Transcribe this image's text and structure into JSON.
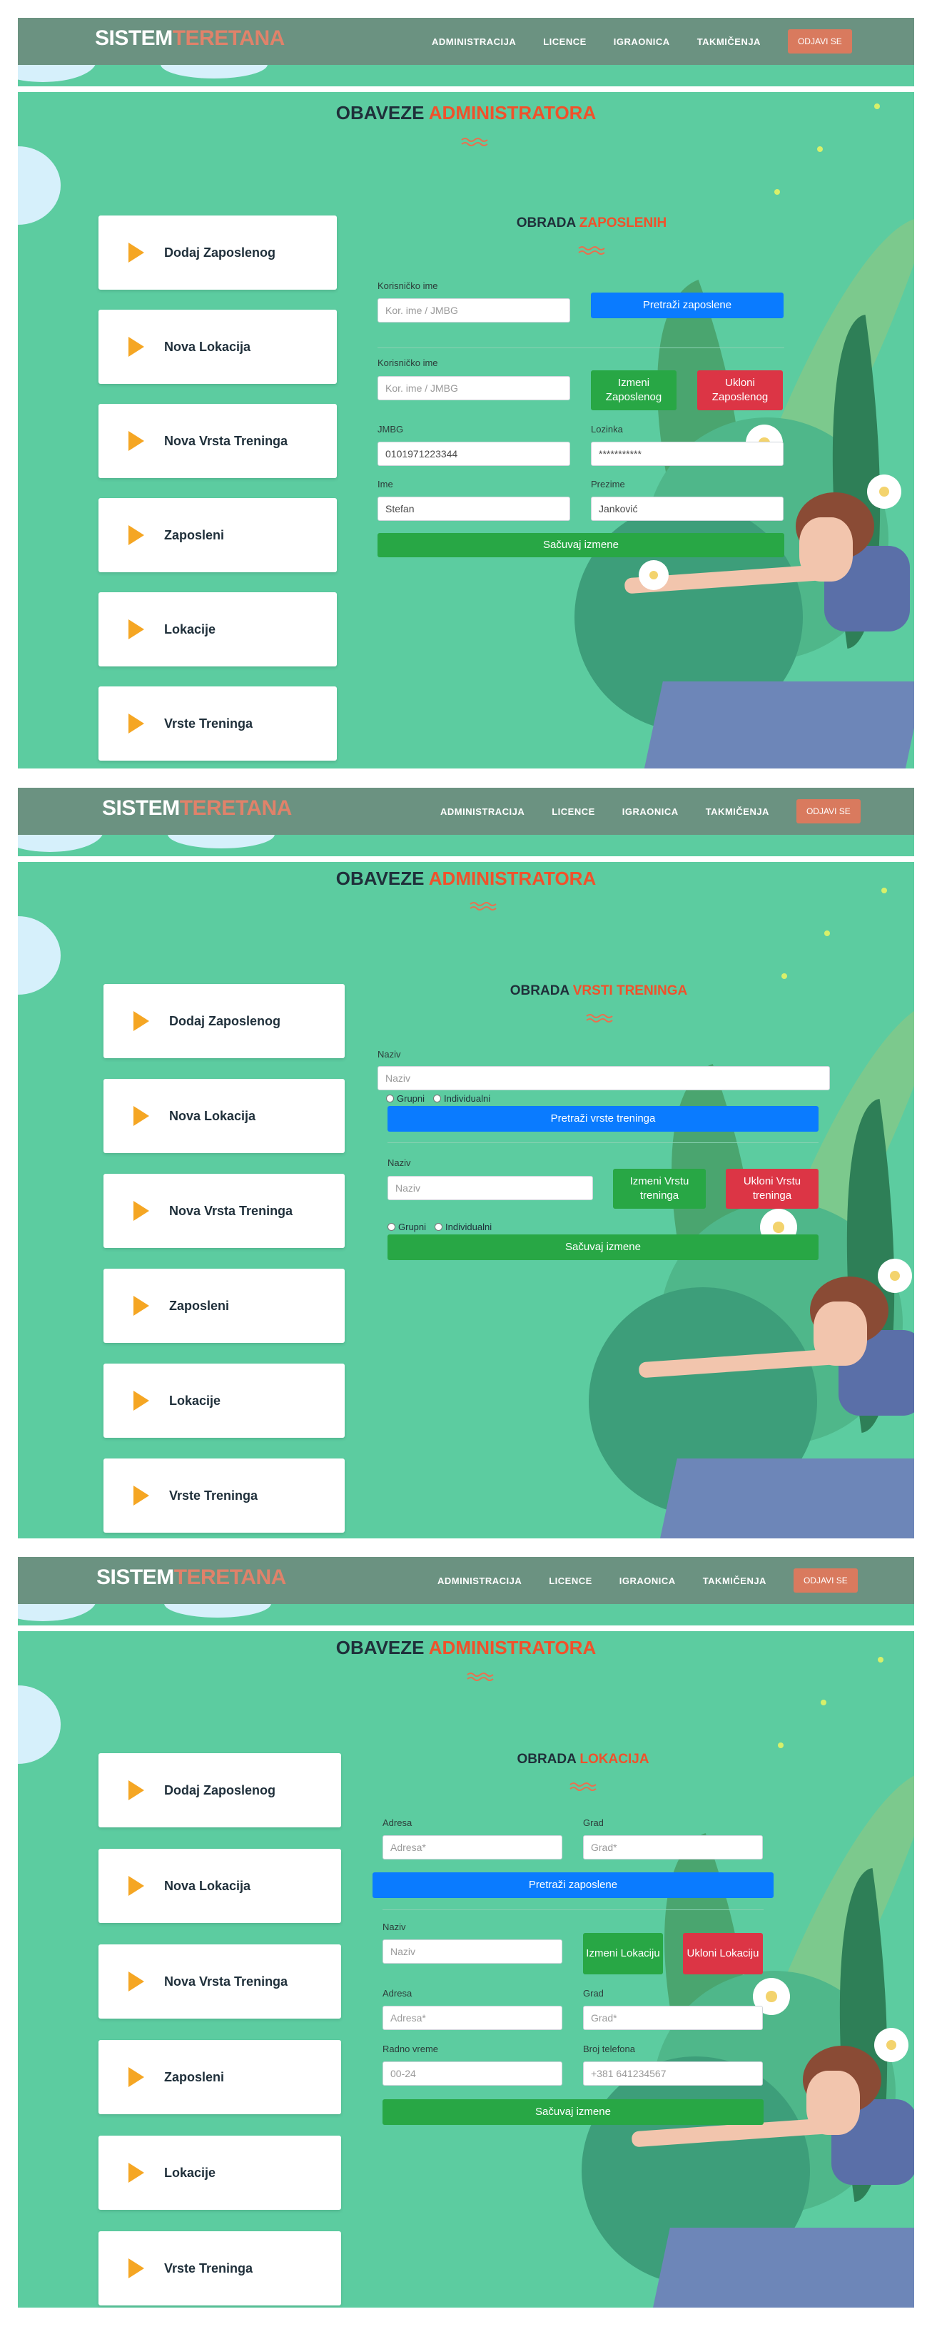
{
  "navbar": {
    "brand_part1": "SISTEM",
    "brand_part2": "TERETANA",
    "links": [
      "ADMINISTRACIJA",
      "LICENCE",
      "IGRAONICA",
      "TAKMIČENJA"
    ],
    "logout_label": "ODJAVI SE"
  },
  "page_title": {
    "part1": "OBAVEZE",
    "part2": "ADMINISTRATORA"
  },
  "sidebar": {
    "items": [
      {
        "label": "Dodaj Zaposlenog"
      },
      {
        "label": "Nova Lokacija"
      },
      {
        "label": "Nova Vrsta Treninga"
      },
      {
        "label": "Zaposleni"
      },
      {
        "label": "Lokacije"
      },
      {
        "label": "Vrste Treninga"
      }
    ]
  },
  "colors": {
    "background": "#5ccca0",
    "navbar": "#6b9281",
    "accent": "#f0512b",
    "brand_accent": "#e0826a",
    "primary": "#0a7bff",
    "success": "#28a745",
    "danger": "#dc3545",
    "arrow": "#f5a623"
  },
  "employees": {
    "title_part1": "OBRADA",
    "title_part2": "ZAPOSLENIH",
    "search": {
      "label": "Korisničko ime",
      "placeholder": "Kor. ime / JMBG",
      "button": "Pretraži zaposlene"
    },
    "edit": {
      "username_label": "Korisničko ime",
      "username_placeholder": "Kor. ime / JMBG",
      "edit_button": "Izmeni Zaposlenog",
      "delete_button": "Ukloni Zaposlenog",
      "jmbg_label": "JMBG",
      "jmbg_value": "0101971223344",
      "password_label": "Lozinka",
      "password_value": "***********",
      "name_label": "Ime",
      "name_value": "Stefan",
      "surname_label": "Prezime",
      "surname_value": "Janković",
      "save_button": "Sačuvaj izmene"
    }
  },
  "training_types": {
    "title_part1": "OBRADA",
    "title_part2": "VRSTI TRENINGA",
    "search": {
      "label": "Naziv",
      "placeholder": "Naziv",
      "radio_group": "Grupni",
      "radio_individual": "Individualni",
      "button": "Pretraži vrste treninga"
    },
    "edit": {
      "name_label": "Naziv",
      "name_placeholder": "Naziv",
      "edit_button": "Izmeni Vrstu treninga",
      "delete_button": "Ukloni Vrstu treninga",
      "radio_group": "Grupni",
      "radio_individual": "Individualni",
      "save_button": "Sačuvaj izmene"
    }
  },
  "locations": {
    "title_part1": "OBRADA",
    "title_part2": "LOKACIJA",
    "search": {
      "address_label": "Adresa",
      "address_placeholder": "Adresa*",
      "city_label": "Grad",
      "city_placeholder": "Grad*",
      "button": "Pretraži zaposlene"
    },
    "edit": {
      "name_label": "Naziv",
      "name_placeholder": "Naziv",
      "edit_button": "Izmeni Lokaciju",
      "delete_button": "Ukloni Lokaciju",
      "address_label": "Adresa",
      "address_placeholder": "Adresa*",
      "city_label": "Grad",
      "city_placeholder": "Grad*",
      "hours_label": "Radno vreme",
      "hours_placeholder": "00-24",
      "phone_label": "Broj telefona",
      "phone_placeholder": "+381 641234567",
      "save_button": "Sačuvaj izmene"
    }
  }
}
